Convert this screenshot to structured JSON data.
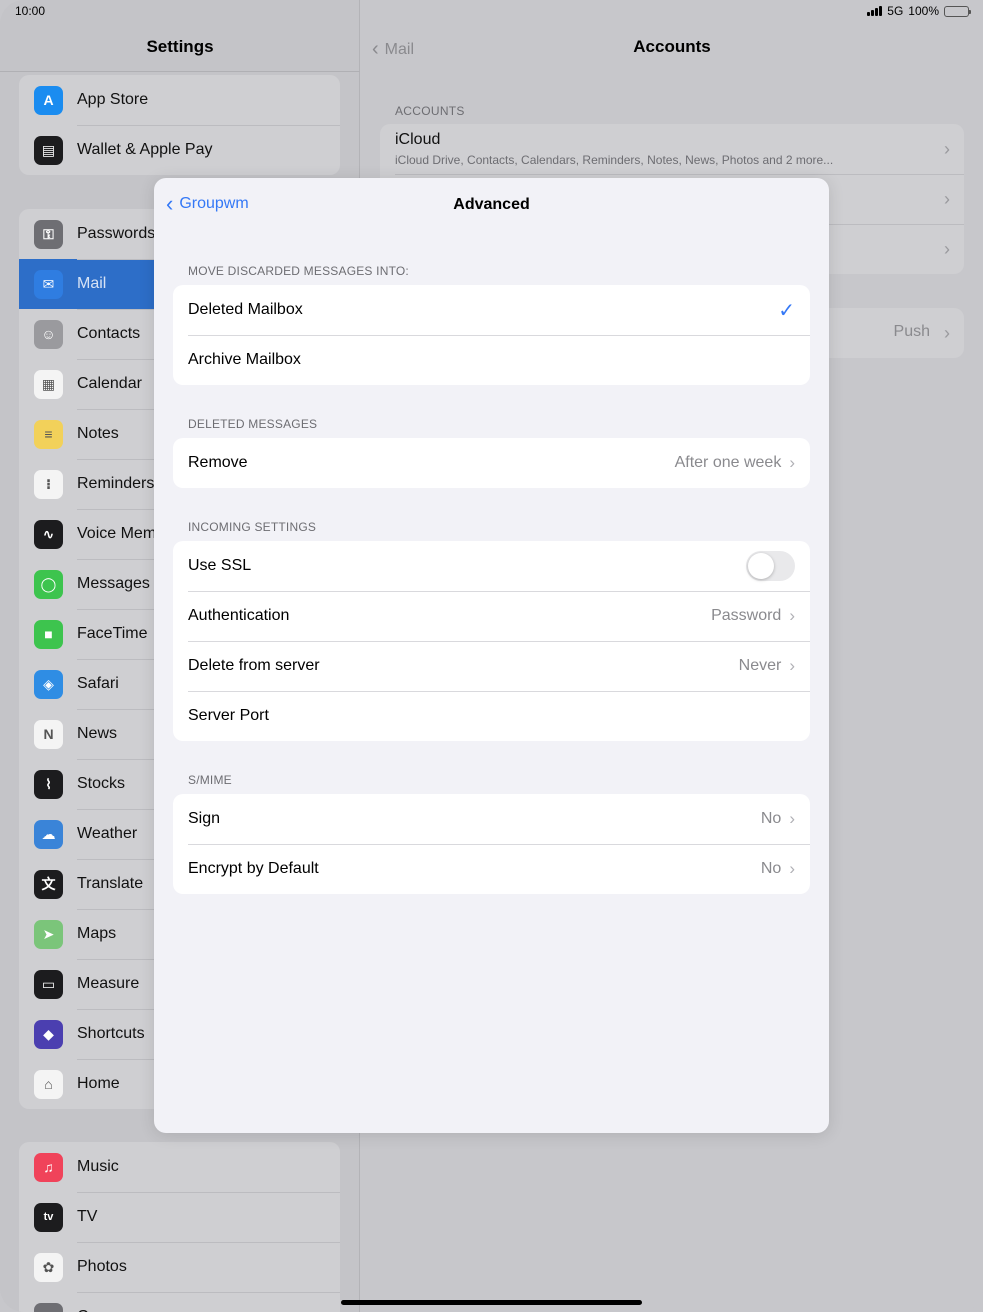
{
  "status": {
    "time": "10:00",
    "network": "5G",
    "battery": "100%"
  },
  "sidebar": {
    "title": "Settings",
    "group1": [
      {
        "label": "App Store",
        "icon": "app-store-icon",
        "color": "#1a8cf0",
        "glyph": "A"
      },
      {
        "label": "Wallet & Apple Pay",
        "icon": "wallet-icon",
        "color": "#1c1c1e",
        "glyph": "▤"
      }
    ],
    "group2": [
      {
        "label": "Passwords",
        "icon": "key-icon",
        "color": "#6e6e73",
        "glyph": "⚿"
      },
      {
        "label": "Mail",
        "icon": "mail-icon",
        "color": "#2f7de1",
        "glyph": "✉",
        "selected": true
      },
      {
        "label": "Contacts",
        "icon": "contacts-icon",
        "color": "#9a9a9e",
        "glyph": "☺"
      },
      {
        "label": "Calendar",
        "icon": "calendar-icon",
        "color": "#f4f4f4",
        "glyph": "▦"
      },
      {
        "label": "Notes",
        "icon": "notes-icon",
        "color": "#f2d15a",
        "glyph": "≡"
      },
      {
        "label": "Reminders",
        "icon": "reminders-icon",
        "color": "#f4f4f4",
        "glyph": "⁝"
      },
      {
        "label": "Voice Memos",
        "icon": "voice-memos-icon",
        "color": "#1c1c1e",
        "glyph": "∿"
      },
      {
        "label": "Messages",
        "icon": "messages-icon",
        "color": "#3dc44e",
        "glyph": "◯"
      },
      {
        "label": "FaceTime",
        "icon": "facetime-icon",
        "color": "#3dc44e",
        "glyph": "■"
      },
      {
        "label": "Safari",
        "icon": "safari-icon",
        "color": "#2f8de4",
        "glyph": "◈"
      },
      {
        "label": "News",
        "icon": "news-icon",
        "color": "#f4f4f4",
        "glyph": "N"
      },
      {
        "label": "Stocks",
        "icon": "stocks-icon",
        "color": "#1c1c1e",
        "glyph": "⌇"
      },
      {
        "label": "Weather",
        "icon": "weather-icon",
        "color": "#3a84d8",
        "glyph": "☁"
      },
      {
        "label": "Translate",
        "icon": "translate-icon",
        "color": "#1c1c1e",
        "glyph": "文"
      },
      {
        "label": "Maps",
        "icon": "maps-icon",
        "color": "#7bc57a",
        "glyph": "➤"
      },
      {
        "label": "Measure",
        "icon": "measure-icon",
        "color": "#1c1c1e",
        "glyph": "▭"
      },
      {
        "label": "Shortcuts",
        "icon": "shortcuts-icon",
        "color": "#4b3fb0",
        "glyph": "◆"
      },
      {
        "label": "Home",
        "icon": "home-icon",
        "color": "#f4f4f4",
        "glyph": "⌂"
      }
    ],
    "group3": [
      {
        "label": "Music",
        "icon": "music-icon",
        "color": "#f0435a",
        "glyph": "♫"
      },
      {
        "label": "TV",
        "icon": "tv-icon",
        "color": "#1c1c1e",
        "glyph": "tv"
      },
      {
        "label": "Photos",
        "icon": "photos-icon",
        "color": "#f4f4f4",
        "glyph": "✿"
      },
      {
        "label": "Camera",
        "icon": "camera-icon",
        "color": "#6e6e73",
        "glyph": "◉"
      }
    ]
  },
  "detail": {
    "back_label": "Mail",
    "title": "Accounts",
    "accounts_header": "ACCOUNTS",
    "icloud_name": "iCloud",
    "icloud_desc": "iCloud Drive, Contacts, Calendars, Reminders, Notes, News, Photos and 2 more...",
    "fetch_value": "Push"
  },
  "modal": {
    "back_label": "Groupwm",
    "title": "Advanced",
    "sections": [
      {
        "header": "MOVE DISCARDED MESSAGES INTO:",
        "rows": [
          {
            "label": "Deleted Mailbox",
            "checked": true
          },
          {
            "label": "Archive Mailbox",
            "checked": false
          }
        ]
      },
      {
        "header": "DELETED MESSAGES",
        "rows": [
          {
            "label": "Remove",
            "value": "After one week"
          }
        ]
      },
      {
        "header": "INCOMING SETTINGS",
        "rows": [
          {
            "label": "Use SSL",
            "toggle": false
          },
          {
            "label": "Authentication",
            "value": "Password"
          },
          {
            "label": "Delete from server",
            "value": "Never"
          },
          {
            "label": "Server Port",
            "value": ""
          }
        ]
      },
      {
        "header": "S/MIME",
        "rows": [
          {
            "label": "Sign",
            "value": "No"
          },
          {
            "label": "Encrypt by Default",
            "value": "No"
          }
        ]
      }
    ]
  },
  "colors": {
    "accent": "#3478f6",
    "selected_row": "#2d6ec8"
  }
}
